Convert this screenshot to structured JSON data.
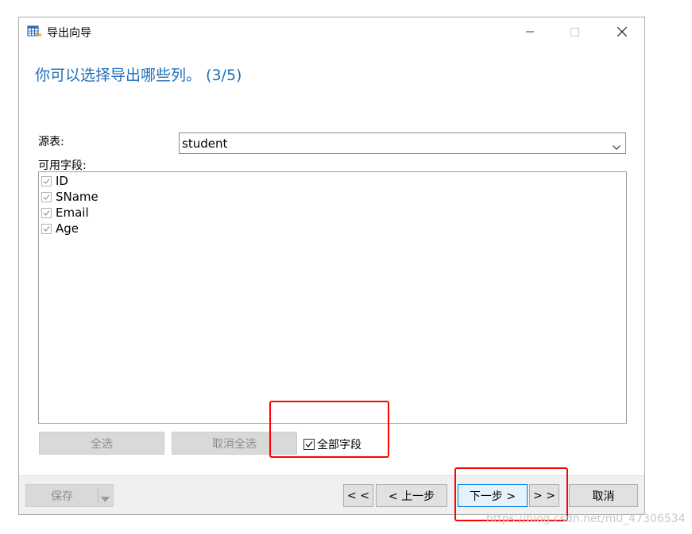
{
  "window": {
    "title": "导出向导",
    "icon": "table-export-icon"
  },
  "heading": "你可以选择导出哪些列。 (3/5)",
  "source_table": {
    "label": "源表:",
    "value": "student"
  },
  "available_fields": {
    "label": "可用字段:",
    "items": [
      {
        "label": "ID",
        "checked": true
      },
      {
        "label": "SName",
        "checked": true
      },
      {
        "label": "Email",
        "checked": true
      },
      {
        "label": "Age",
        "checked": true
      }
    ]
  },
  "buttons": {
    "select_all": "全选",
    "deselect_all": "取消全选",
    "all_fields": "全部字段",
    "save": "保存",
    "first": "< <",
    "back": "< 上一步",
    "next": "下一步 >",
    "last": "> >",
    "cancel": "取消"
  },
  "all_fields_checked": true,
  "watermark": "https://blog.csdn.net/m0_47306534",
  "colors": {
    "heading": "#1e6fb7",
    "highlight_box": "#ff0000",
    "default_button_border": "#0078d7"
  }
}
